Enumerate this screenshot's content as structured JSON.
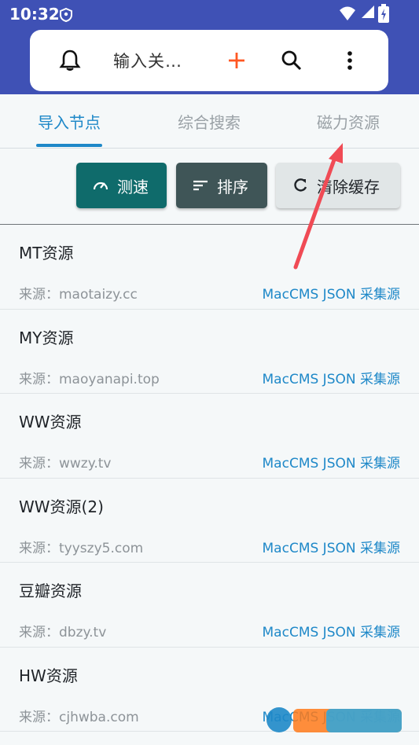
{
  "status_bar": {
    "time": "10:32"
  },
  "toolbar": {
    "search_text": "输入关…",
    "icons": [
      "bell-icon",
      "plus-icon",
      "search-icon",
      "more-vert-icon"
    ],
    "accent": "#ff5722"
  },
  "tabs": [
    {
      "label": "导入节点",
      "active": true
    },
    {
      "label": "综合搜索",
      "active": false
    },
    {
      "label": "磁力资源",
      "active": false
    }
  ],
  "actions": {
    "speed_label": "测速",
    "sort_label": "排序",
    "clear_label": "清除缓存"
  },
  "sources": [
    {
      "name": "MT资源",
      "source": "来源：maotaizy.cc",
      "type": "MacCMS JSON 采集源"
    },
    {
      "name": "MY资源",
      "source": "来源：maoyanapi.top",
      "type": "MacCMS JSON 采集源"
    },
    {
      "name": "WW资源",
      "source": "来源：wwzy.tv",
      "type": "MacCMS JSON 采集源"
    },
    {
      "name": "WW资源(2)",
      "source": "来源：tyyszy5.com",
      "type": "MacCMS JSON 采集源"
    },
    {
      "name": "豆瓣资源",
      "source": "来源：dbzy.tv",
      "type": "MacCMS JSON 采集源"
    },
    {
      "name": "HW资源",
      "source": "来源：cjhwba.com",
      "type": "MacCMS JSON 采集源"
    }
  ],
  "colors": {
    "header": "#3f51b5",
    "tab_active": "#1e88c8",
    "speed_button": "#0f6b6b",
    "sort_button": "#3f5557",
    "annotation_arrow": "#f04b55"
  }
}
